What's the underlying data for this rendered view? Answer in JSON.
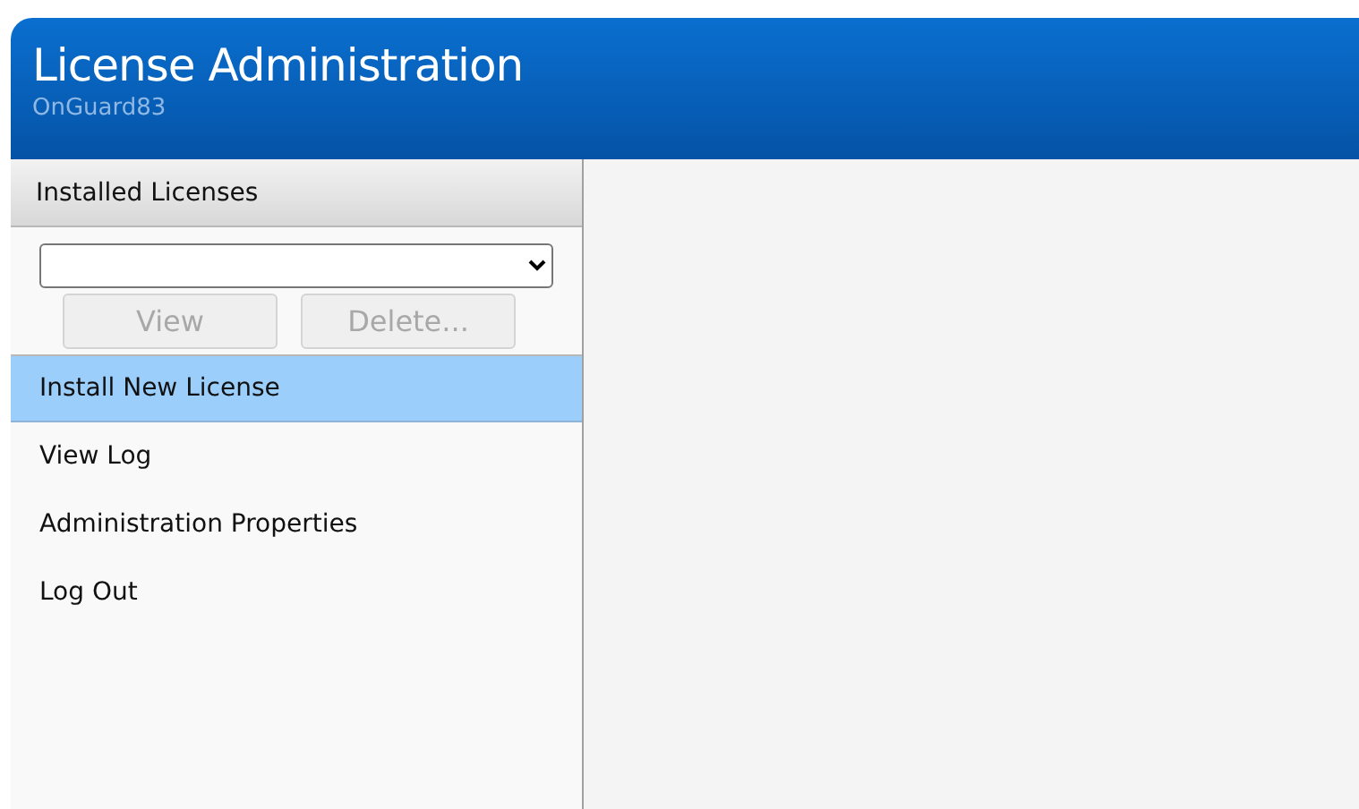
{
  "header": {
    "title": "License Administration",
    "subtitle": "OnGuard83"
  },
  "sidebar": {
    "section_title": "Installed Licenses",
    "buttons": [
      {
        "label": "View",
        "disabled": true
      },
      {
        "label": "Delete...",
        "disabled": true
      }
    ],
    "menu": [
      {
        "label": "Install New License",
        "selected": true
      },
      {
        "label": "View Log",
        "selected": false
      },
      {
        "label": "Administration Properties",
        "selected": false
      },
      {
        "label": "Log Out",
        "selected": false
      }
    ]
  }
}
